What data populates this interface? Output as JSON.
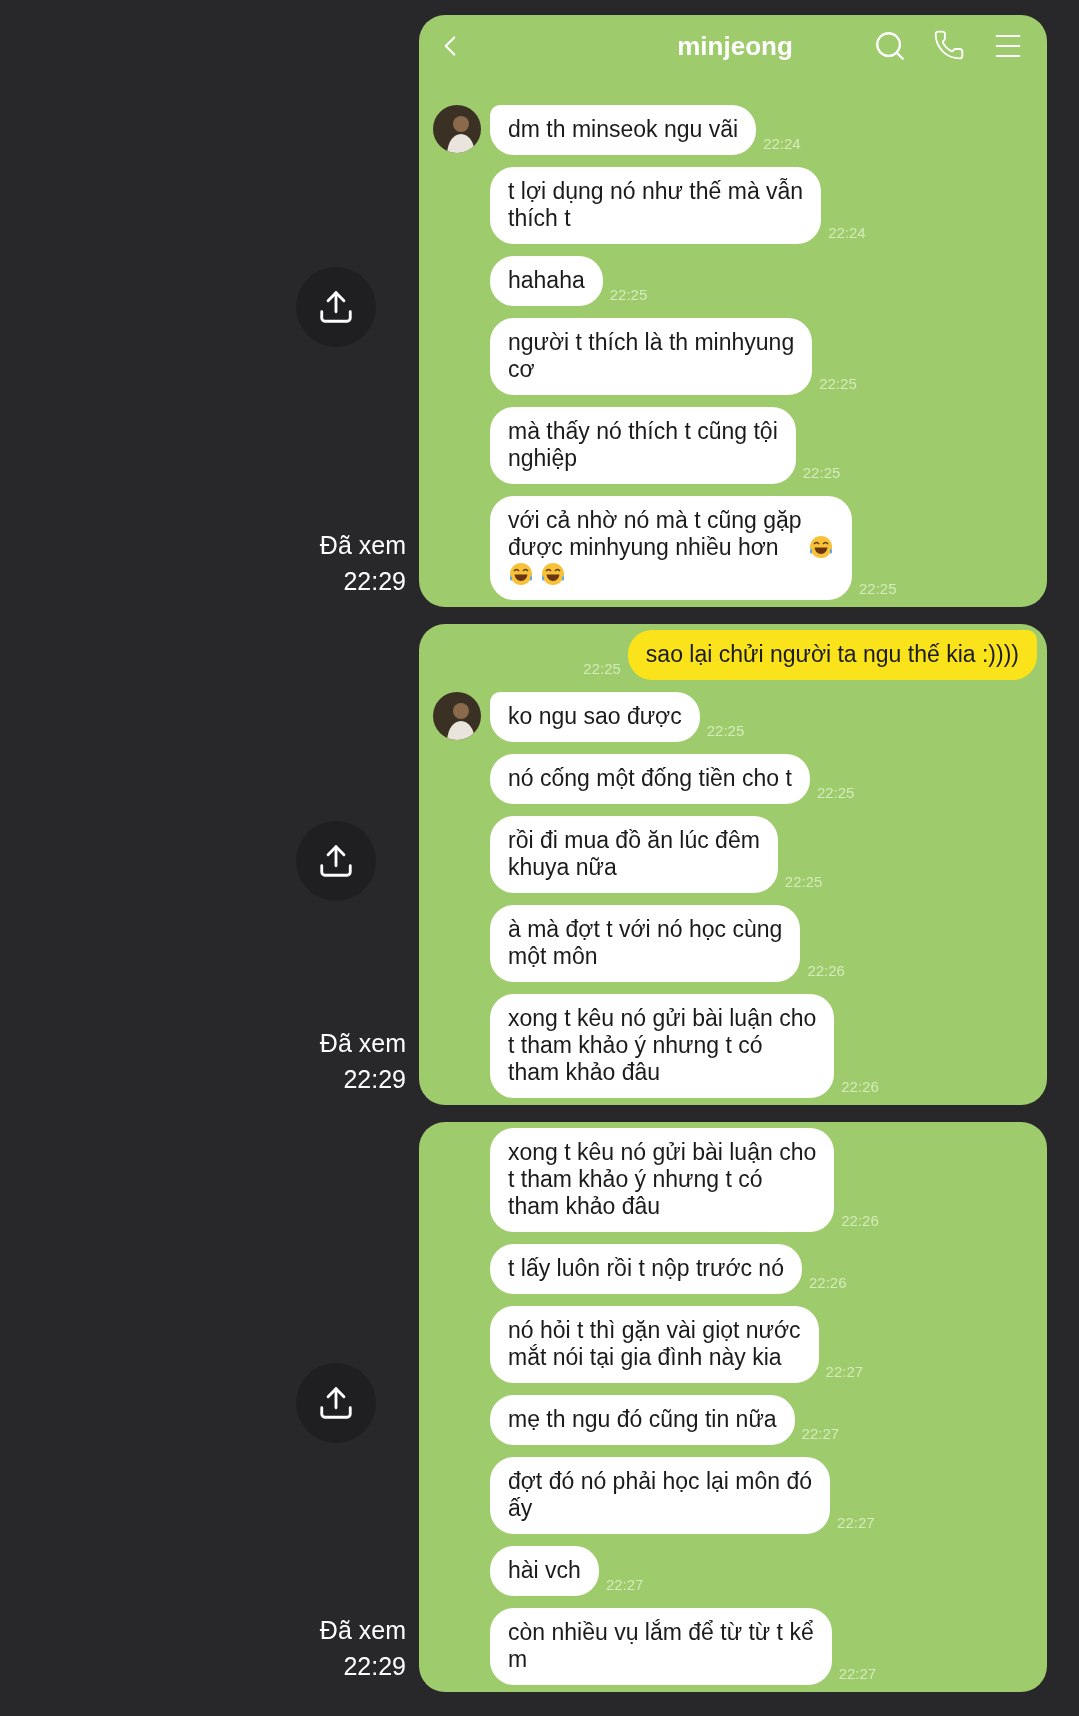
{
  "sections": [
    {
      "header": {
        "title": "minjeong"
      },
      "read_label": "Đã xem",
      "read_time": "22:29",
      "messages": [
        {
          "kind": "received",
          "avatar": true,
          "lines": [
            "dm th minseok ngu vãi"
          ],
          "time": "22:24"
        },
        {
          "kind": "received",
          "avatar": false,
          "lines": [
            "t lợi dụng nó như thế mà vẫn",
            "thích t"
          ],
          "time": "22:24"
        },
        {
          "kind": "received",
          "avatar": false,
          "lines": [
            "hahaha"
          ],
          "time": "22:25"
        },
        {
          "kind": "received",
          "avatar": false,
          "lines": [
            "người t thích là th minhyung",
            "cơ"
          ],
          "time": "22:25"
        },
        {
          "kind": "received",
          "avatar": false,
          "lines": [
            "mà thấy nó thích t cũng tội",
            "nghiệp"
          ],
          "time": "22:25"
        },
        {
          "kind": "received",
          "avatar": false,
          "lines": [
            "với cả nhờ nó mà t cũng gặp",
            "được minhyung nhiều hơn"
          ],
          "time": "22:25",
          "emoji_lines": [
            [
              {
                "kind": "laugh"
              }
            ],
            [
              {
                "kind": "laugh"
              },
              {
                "kind": "laugh"
              }
            ]
          ]
        }
      ]
    },
    {
      "read_label": "Đã xem",
      "read_time": "22:29",
      "messages": [
        {
          "kind": "sent",
          "lines": [
            "sao lại chửi người ta ngu thế kia :))))"
          ],
          "time": "22:25"
        },
        {
          "kind": "received",
          "avatar": true,
          "lines": [
            "ko ngu sao được"
          ],
          "time": "22:25"
        },
        {
          "kind": "received",
          "avatar": false,
          "lines": [
            "nó cống một đống tiền cho t"
          ],
          "time": "22:25"
        },
        {
          "kind": "received",
          "avatar": false,
          "lines": [
            "rồi đi mua đồ ăn lúc đêm",
            "khuya nữa"
          ],
          "time": "22:25"
        },
        {
          "kind": "received",
          "avatar": false,
          "lines": [
            "à mà đợt t với nó học cùng",
            "một môn"
          ],
          "time": "22:26"
        },
        {
          "kind": "received",
          "avatar": false,
          "lines": [
            "xong t kêu nó gửi bài luận cho",
            "t tham khảo ý nhưng t có",
            "tham khảo đâu"
          ],
          "time": "22:26"
        }
      ]
    },
    {
      "read_label": "Đã xem",
      "read_time": "22:29",
      "messages": [
        {
          "kind": "received",
          "avatar": false,
          "lines": [
            "xong t kêu nó gửi bài luận cho",
            "t tham khảo ý nhưng t có",
            "tham khảo đâu"
          ],
          "time": "22:26"
        },
        {
          "kind": "received",
          "avatar": false,
          "lines": [
            "t lấy luôn rồi t nộp trước nó"
          ],
          "time": "22:26"
        },
        {
          "kind": "received",
          "avatar": false,
          "lines": [
            "nó hỏi t thì gặn vài giọt nước",
            "mắt nói tại gia đình này kia"
          ],
          "time": "22:27"
        },
        {
          "kind": "received",
          "avatar": false,
          "lines": [
            "mẹ th ngu đó cũng tin nữa"
          ],
          "time": "22:27"
        },
        {
          "kind": "received",
          "avatar": false,
          "lines": [
            "đợt đó nó phải học lại môn đó",
            "ấy"
          ],
          "time": "22:27"
        },
        {
          "kind": "received",
          "avatar": false,
          "lines": [
            "hài vch"
          ],
          "time": "22:27"
        },
        {
          "kind": "received",
          "avatar": false,
          "lines": [
            "còn nhiều vụ lắm để từ từ t kể",
            "m"
          ],
          "time": "22:27"
        }
      ]
    }
  ]
}
